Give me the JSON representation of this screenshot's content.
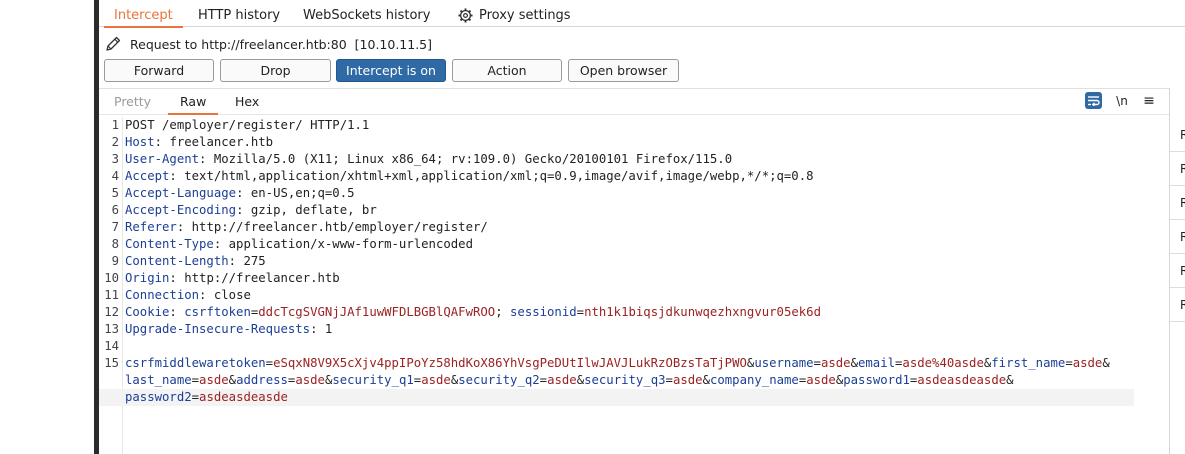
{
  "proxy_tabs": [
    "Intercept",
    "HTTP history",
    "WebSockets history",
    "Proxy settings"
  ],
  "active_proxy_tab": "Intercept",
  "request_target": "Request to http://freelancer.htb:80",
  "request_ip": "[10.10.11.5]",
  "buttons": {
    "forward": "Forward",
    "drop": "Drop",
    "intercept": "Intercept is on",
    "action": "Action",
    "open_browser": "Open browser"
  },
  "editor_tabs": [
    "Pretty",
    "Raw",
    "Hex"
  ],
  "active_editor_tab": "Raw",
  "editor_tools": {
    "newline": "\\n",
    "menu": "≡"
  },
  "inspector_rows": [
    "R",
    "R",
    "R",
    "R",
    "R",
    "R"
  ],
  "request": {
    "request_line": "POST /employer/register/ HTTP/1.1",
    "headers": [
      {
        "name": "Host",
        "value": "freelancer.htb"
      },
      {
        "name": "User-Agent",
        "value": "Mozilla/5.0 (X11; Linux x86_64; rv:109.0) Gecko/20100101 Firefox/115.0"
      },
      {
        "name": "Accept",
        "value": "text/html,application/xhtml+xml,application/xml;q=0.9,image/avif,image/webp,*/*;q=0.8"
      },
      {
        "name": "Accept-Language",
        "value": "en-US,en;q=0.5"
      },
      {
        "name": "Accept-Encoding",
        "value": "gzip, deflate, br"
      },
      {
        "name": "Referer",
        "value": "http://freelancer.htb/employer/register/"
      },
      {
        "name": "Content-Type",
        "value": "application/x-www-form-urlencoded"
      },
      {
        "name": "Content-Length",
        "value": "275"
      },
      {
        "name": "Origin",
        "value": "http://freelancer.htb"
      },
      {
        "name": "Connection",
        "value": "close"
      }
    ],
    "cookie_header": "Cookie",
    "cookies": [
      {
        "name": "csrftoken",
        "value": "ddcTcgSVGNjJAf1uwWFDLBGBlQAFwROO"
      },
      {
        "name": "sessionid",
        "value": "nth1k1biqsjdkunwqezhxngvur05ek6d"
      }
    ],
    "last_header": {
      "name": "Upgrade-Insecure-Requests",
      "value": "1"
    },
    "body_params": [
      {
        "name": "csrfmiddlewaretoken",
        "value": "eSqxN8V9X5cXjv4ppIPoYz58hdKoX86YhVsgPeDUtIlwJAVJLukRzOBzsTaTjPWO"
      },
      {
        "name": "username",
        "value": "asde"
      },
      {
        "name": "email",
        "value": "asde%40asde"
      },
      {
        "name": "first_name",
        "value": "asde"
      },
      {
        "name": "last_name",
        "value": "asde"
      },
      {
        "name": "address",
        "value": "asde"
      },
      {
        "name": "security_q1",
        "value": "asde"
      },
      {
        "name": "security_q2",
        "value": "asde"
      },
      {
        "name": "security_q3",
        "value": "asde"
      },
      {
        "name": "company_name",
        "value": "asde"
      },
      {
        "name": "password1",
        "value": "asdeasdeasde"
      },
      {
        "name": "password2",
        "value": "asdeasdeasde"
      }
    ]
  },
  "colors": {
    "accent_orange": "#e8743b",
    "primary_blue": "#2f6aa6",
    "param_name": "#1c3f95",
    "param_value": "#9b2222"
  }
}
